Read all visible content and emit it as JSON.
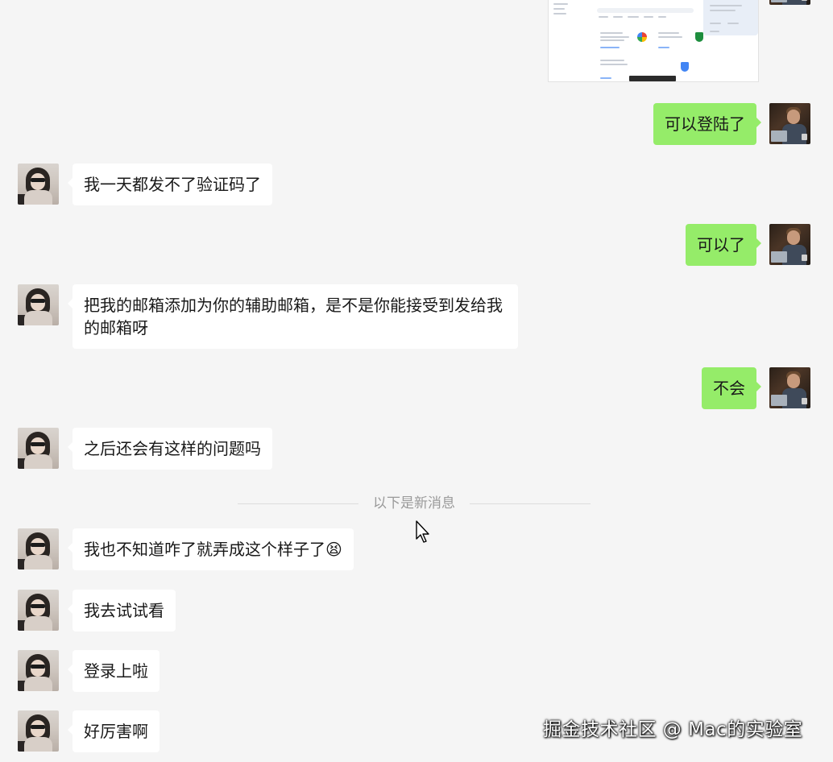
{
  "messages": [
    {
      "side": "out",
      "kind": "image",
      "alt": "screenshot"
    },
    {
      "side": "out",
      "text": "可以登陆了"
    },
    {
      "side": "in",
      "text": "我一天都发不了验证码了"
    },
    {
      "side": "out",
      "text": "可以了"
    },
    {
      "side": "in",
      "text": "把我的邮箱添加为你的辅助邮箱，是不是你能接受到发给我的邮箱呀"
    },
    {
      "side": "out",
      "text": "不会"
    },
    {
      "side": "in",
      "text": "之后还会有这样的问题吗"
    },
    {
      "side": "in",
      "text": "我也不知道咋了就弄成这个样子了"
    },
    {
      "side": "in",
      "text": "我去试试看"
    },
    {
      "side": "in",
      "text": "登录上啦"
    },
    {
      "side": "in",
      "text": "好厉害啊"
    }
  ],
  "divider": {
    "text": "以下是新消息"
  },
  "emoji": "😫",
  "watermark": "掘金技术社区 @ Mac的实验室",
  "colors": {
    "background": "#f5f5f5",
    "outgoing_bubble": "#95ec69",
    "incoming_bubble": "#ffffff"
  }
}
